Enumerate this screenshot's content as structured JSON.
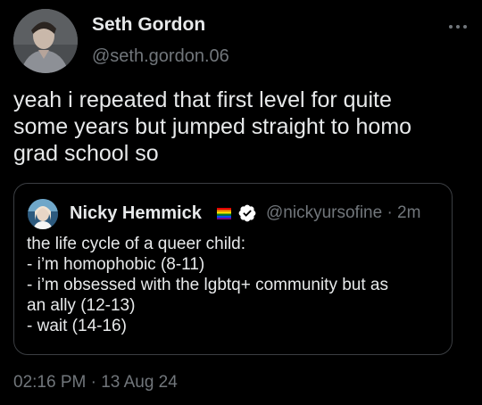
{
  "author": {
    "name": "Seth Gordon",
    "handle": "@seth.gordon.06"
  },
  "tweet": {
    "lines": [
      "yeah i repeated that first level for quite",
      "some years but jumped straight to homo",
      "grad school so"
    ]
  },
  "quoted": {
    "name": "Nicky Hemmick",
    "meta": "@nickyursofine · 2m",
    "lines": [
      "the life cycle of a queer child:",
      "- i’m homophobic (8-11)",
      "- i’m obsessed with the lgbtq+ community but as",
      "an ally (12-13)",
      "- wait (14-16)"
    ]
  },
  "timestamp": "02:16 PM · 13 Aug 24",
  "icons": {
    "more": "more-icon",
    "flag": "rainbow-flag-icon",
    "verified": "verified-badge-icon"
  },
  "colors": {
    "background": "#000000",
    "primary_text": "#e7e9ea",
    "secondary_text": "#71767b",
    "verified": "#1d9bf0",
    "border": "#3b3e42"
  }
}
